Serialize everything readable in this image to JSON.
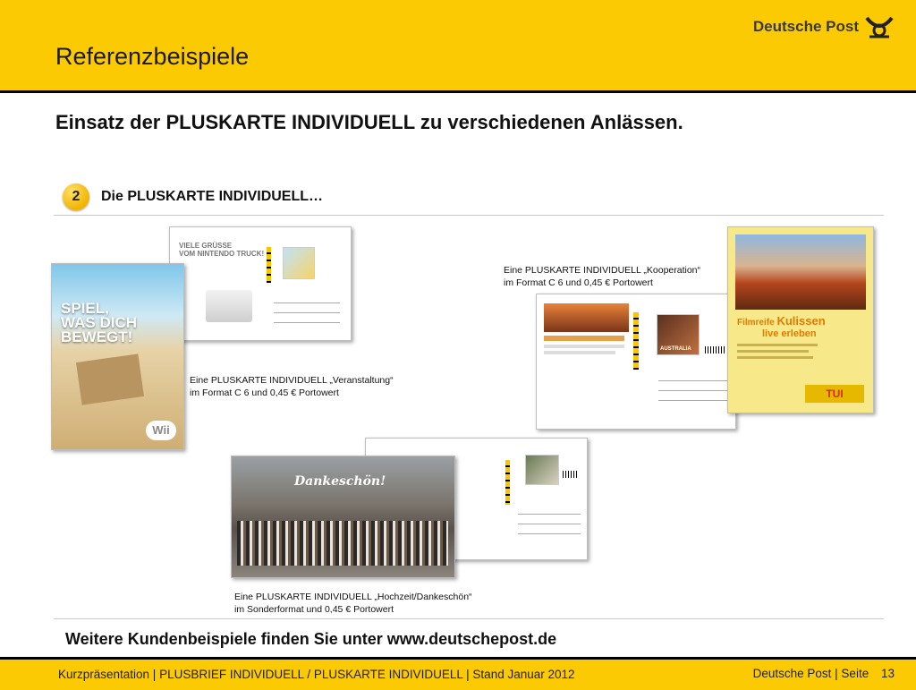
{
  "header": {
    "title": "Referenzbeispiele",
    "logo_text": "Deutsche Post"
  },
  "main": {
    "subtitle": "Einsatz der PLUSKARTE INDIVIDUELL zu verschiedenen Anlässen.",
    "section": {
      "number": "2",
      "label": "Die PLUSKARTE INDIVIDUELL…"
    },
    "cards": {
      "nintendo": {
        "headline_1": "VIELE GRÜSSE",
        "headline_2": "VOM NINTENDO TRUCK!",
        "front_text_1": "SPIEL,",
        "front_text_2": "WAS DICH",
        "front_text_3": "BEWEGT!",
        "brand": "Wii",
        "caption_line1": "Eine PLUSKARTE INDIVIDUELL „Veranstaltung“",
        "caption_line2": "im Format C 6 und 0,45 € Portowert"
      },
      "tui": {
        "headline_1": "Filmreife",
        "headline_2": "Kulissen",
        "headline_3": "live erleben",
        "brand": "TUI",
        "stamp_label": "AUSTRALIA",
        "caption_line1": "Eine PLUSKARTE INDIVIDUELL „Kooperation“",
        "caption_line2": "im Format C 6 und 0,45 € Portowert"
      },
      "wedding": {
        "headline": "Dankeschön!",
        "caption_line1": "Eine PLUSKARTE INDIVIDUELL „Hochzeit/Dankeschön“",
        "caption_line2": "im Sonderformat und 0,45 € Portowert"
      }
    },
    "footer_note": "Weitere Kundenbeispiele finden Sie unter www.deutschepost.de"
  },
  "footer": {
    "left_text": "Kurzpräsentation | PLUSBRIEF INDIVIDUELL / PLUSKARTE INDIVIDUELL | Stand Januar 2012",
    "right_text": "Deutsche Post | Seite",
    "slide_number": "13"
  },
  "colors": {
    "brand_yellow": "#fcca03",
    "rule_gray": "#c8c8c8"
  }
}
